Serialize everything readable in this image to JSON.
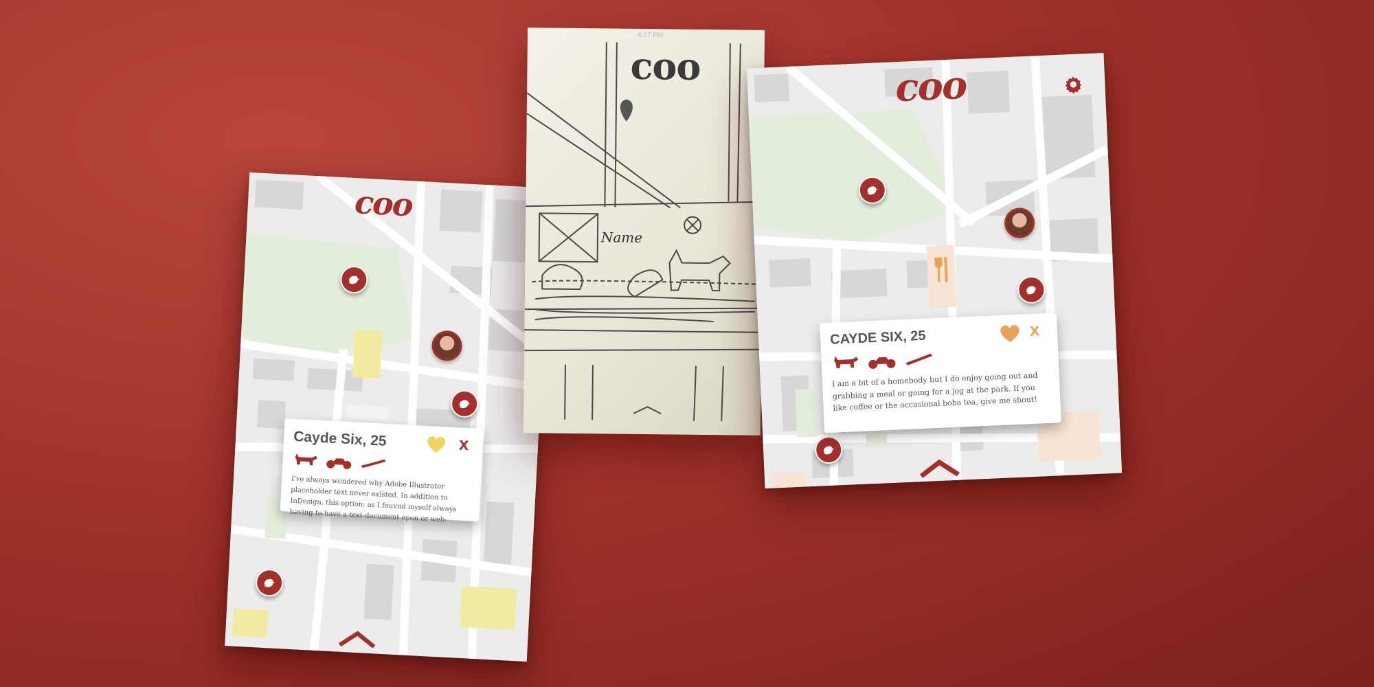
{
  "app": {
    "logo": "coo"
  },
  "left_screen": {
    "logo": "coo",
    "card": {
      "name": "Cayde Six, 25",
      "close": "x",
      "bio": "I've always wondered why Adobe Illustrator placeholder text never existed. In addition to InDesign, this option; as I fouvnd myself always having to have a text document open or web-"
    },
    "icons": [
      "corgi-icon",
      "motorcycle-icon",
      "skateboard-icon",
      "lemon-heart-icon",
      "bird-icon",
      "chevron-up-icon"
    ]
  },
  "sketch_screen": {
    "time": "4:17 PM",
    "logo": "coo",
    "name_label": "Name",
    "icons": [
      "cupcake-icon",
      "skateboard-icon",
      "corgi-icon",
      "pin-icon",
      "close-circle-icon",
      "chevron-up-icon"
    ]
  },
  "right_screen": {
    "logo": "coo",
    "card": {
      "name": "CAYDE SIX, 25",
      "close": "x",
      "bio": "I am a bit of a homebody but I do enjoy going out and grabbing a meal or going for a jog at the park. If you like coffee or the occasional boba tea, give me shout!"
    },
    "icons": [
      "gear-icon",
      "corgi-icon",
      "motorcycle-icon",
      "skateboard-icon",
      "lemon-heart-icon",
      "fork-knife-icon",
      "bird-icon",
      "chevron-up-icon"
    ]
  },
  "colors": {
    "brand": "#a3302a",
    "background": "#a2332b",
    "map_bg": "#ececec",
    "park": "#e3eddc",
    "accent_yellow": "#f1eaa0",
    "accent_peach": "#f7e4d2"
  }
}
